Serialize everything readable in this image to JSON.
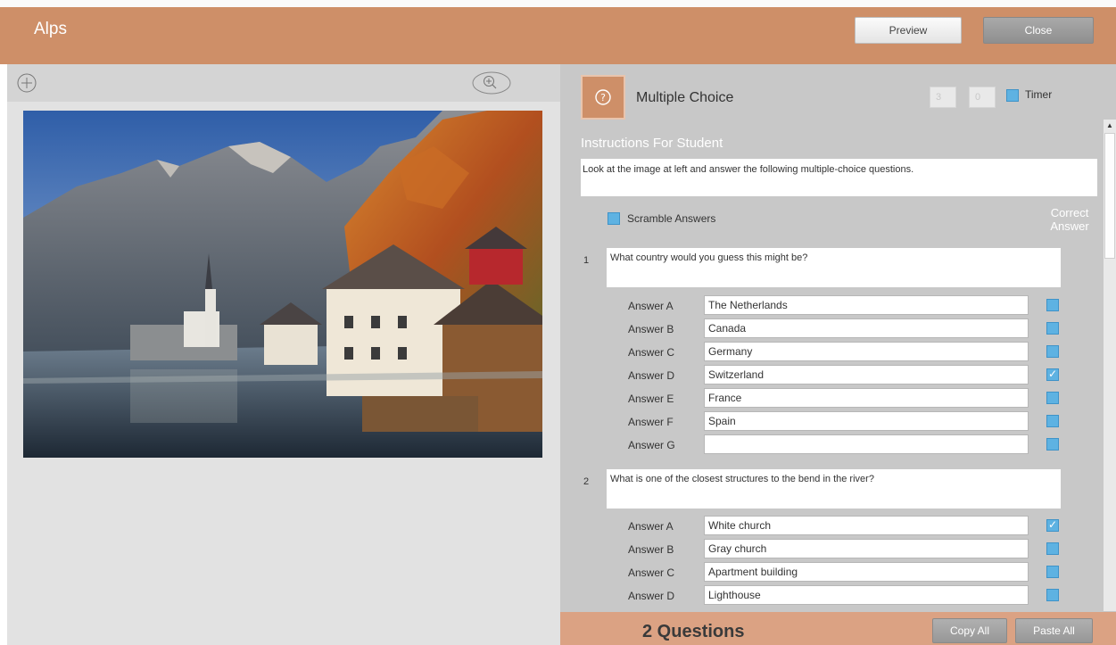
{
  "app": {
    "title": "Alps"
  },
  "header": {
    "preview_label": "Preview",
    "close_label": "Close"
  },
  "left_toolbar": {
    "icons": [
      "add-icon",
      "zoom-in-icon"
    ]
  },
  "image": {
    "subject": "alpine-lake-village-photo"
  },
  "question_type": {
    "label": "Multiple Choice",
    "icon": "question-circle-icon"
  },
  "timer": {
    "minutes": "3",
    "seconds": "0",
    "label": "Timer",
    "checked": false
  },
  "instructions": {
    "heading": "Instructions For Student",
    "text": "Look at the image at left and answer the following multiple-choice questions."
  },
  "scramble": {
    "label": "Scramble Answers",
    "checked": false
  },
  "correct_answer_heading": {
    "line1": "Correct",
    "line2": "Answer"
  },
  "questions": [
    {
      "number": "1",
      "text": "What country would you guess this might be?",
      "answers": [
        {
          "label": "Answer A",
          "value": "The Netherlands",
          "correct": false
        },
        {
          "label": "Answer B",
          "value": "Canada",
          "correct": false
        },
        {
          "label": "Answer C",
          "value": "Germany",
          "correct": false
        },
        {
          "label": "Answer D",
          "value": "Switzerland",
          "correct": true
        },
        {
          "label": "Answer E",
          "value": "France",
          "correct": false
        },
        {
          "label": "Answer F",
          "value": "Spain",
          "correct": false
        },
        {
          "label": "Answer G",
          "value": "",
          "correct": false
        }
      ]
    },
    {
      "number": "2",
      "text": "What is one of the closest structures to the bend in the river?",
      "answers": [
        {
          "label": "Answer A",
          "value": "White church",
          "correct": true
        },
        {
          "label": "Answer B",
          "value": "Gray church",
          "correct": false
        },
        {
          "label": "Answer C",
          "value": "Apartment building",
          "correct": false
        },
        {
          "label": "Answer D",
          "value": "Lighthouse",
          "correct": false
        }
      ]
    }
  ],
  "footer": {
    "count_label": "2 Questions",
    "copy_all_label": "Copy All",
    "paste_all_label": "Paste All"
  },
  "colors": {
    "accent": "#ce8f68",
    "footer": "#dba283",
    "checkbox": "#5eb2e2",
    "panel": "#c8c8c8"
  }
}
